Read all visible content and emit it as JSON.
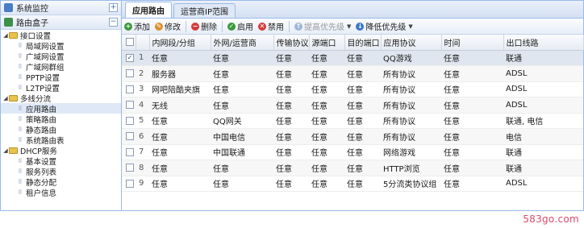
{
  "accordion": [
    {
      "label": "系统监控",
      "toggle": "+",
      "icon_color": "#4a7cc7"
    },
    {
      "label": "路由盒子",
      "toggle": "−",
      "icon_color": "#3d8f4a"
    }
  ],
  "tree": [
    {
      "label": "接口设置",
      "type": "folder",
      "level": 0,
      "arrow": "◢"
    },
    {
      "label": "局域网设置",
      "type": "leaf",
      "level": 1
    },
    {
      "label": "广域网设置",
      "type": "leaf",
      "level": 1
    },
    {
      "label": "广域网群组",
      "type": "leaf",
      "level": 1
    },
    {
      "label": "PPTP设置",
      "type": "leaf",
      "level": 1
    },
    {
      "label": "L2TP设置",
      "type": "leaf",
      "level": 1
    },
    {
      "label": "多线分流",
      "type": "folder",
      "level": 0,
      "arrow": "◢"
    },
    {
      "label": "应用路由",
      "type": "leaf",
      "level": 1,
      "selected": true
    },
    {
      "label": "策略路由",
      "type": "leaf",
      "level": 1
    },
    {
      "label": "静态路由",
      "type": "leaf",
      "level": 1
    },
    {
      "label": "系统路由表",
      "type": "leaf",
      "level": 1
    },
    {
      "label": "DHCP服务",
      "type": "folder",
      "level": 0,
      "arrow": "◢"
    },
    {
      "label": "基本设置",
      "type": "leaf",
      "level": 1
    },
    {
      "label": "服务列表",
      "type": "leaf",
      "level": 1
    },
    {
      "label": "静态分配",
      "type": "leaf",
      "level": 1
    },
    {
      "label": "租户信息",
      "type": "leaf",
      "level": 1
    }
  ],
  "tabs": [
    {
      "label": "应用路由",
      "active": true
    },
    {
      "label": "运营商IP范围",
      "active": false
    }
  ],
  "toolbar": [
    {
      "label": "添加",
      "icon": "add-icon",
      "color": "#3a9a3a",
      "glyph": "+",
      "disabled": false
    },
    {
      "label": "修改",
      "icon": "edit-icon",
      "color": "#d9902a",
      "glyph": "✎",
      "disabled": false
    },
    {
      "label": "删除",
      "icon": "delete-icon",
      "color": "#d33b3b",
      "glyph": "−",
      "disabled": false,
      "sep_before": true
    },
    {
      "label": "启用",
      "icon": "enable-icon",
      "color": "#3a9a3a",
      "glyph": "✓",
      "disabled": false,
      "sep_before": true
    },
    {
      "label": "禁用",
      "icon": "disable-icon",
      "color": "#d33b3b",
      "glyph": "✕",
      "disabled": false
    },
    {
      "label": "提高优先级",
      "icon": "priority-up-icon",
      "color": "#9fb6d8",
      "glyph": "↑",
      "disabled": true,
      "caret": true,
      "sep_before": true
    },
    {
      "label": "降低优先级",
      "icon": "priority-down-icon",
      "color": "#3b78c4",
      "glyph": "↓",
      "disabled": false,
      "caret": true
    }
  ],
  "columns": [
    "",
    "",
    "内网段/分组",
    "外网/运营商",
    "传输协议",
    "源端口",
    "目的端口",
    "应用协议",
    "时间",
    "出口线路"
  ],
  "rows": [
    {
      "num": "1",
      "lan": "任意",
      "wan": "任意",
      "proto": "任意",
      "src": "任意",
      "dst": "任意",
      "app": "QQ游戏",
      "time": "任意",
      "line": "联通",
      "checked": true
    },
    {
      "num": "2",
      "lan": "服务器",
      "wan": "任意",
      "proto": "任意",
      "src": "任意",
      "dst": "任意",
      "app": "所有协议",
      "time": "任意",
      "line": "ADSL",
      "checked": false
    },
    {
      "num": "3",
      "lan": "网吧陪酷夹旗",
      "wan": "任意",
      "proto": "任意",
      "src": "任意",
      "dst": "任意",
      "app": "所有协议",
      "time": "任意",
      "line": "ADSL",
      "checked": false
    },
    {
      "num": "4",
      "lan": "无线",
      "wan": "任意",
      "proto": "任意",
      "src": "任意",
      "dst": "任意",
      "app": "所有协议",
      "time": "任意",
      "line": "ADSL",
      "checked": false
    },
    {
      "num": "5",
      "lan": "任意",
      "wan": "QQ网关",
      "proto": "任意",
      "src": "任意",
      "dst": "任意",
      "app": "所有协议",
      "time": "任意",
      "line": "联通, 电信",
      "checked": false
    },
    {
      "num": "6",
      "lan": "任意",
      "wan": "中国电信",
      "proto": "任意",
      "src": "任意",
      "dst": "任意",
      "app": "所有协议",
      "time": "任意",
      "line": "电信",
      "checked": false
    },
    {
      "num": "7",
      "lan": "任意",
      "wan": "中国联通",
      "proto": "任意",
      "src": "任意",
      "dst": "任意",
      "app": "网络游戏",
      "time": "任意",
      "line": "联通",
      "checked": false
    },
    {
      "num": "8",
      "lan": "任意",
      "wan": "任意",
      "proto": "任意",
      "src": "任意",
      "dst": "任意",
      "app": "HTTP浏览",
      "time": "任意",
      "line": "联通",
      "checked": false
    },
    {
      "num": "9",
      "lan": "任意",
      "wan": "任意",
      "proto": "任意",
      "src": "任意",
      "dst": "任意",
      "app": "5分流类协议组",
      "time": "任意",
      "line": "ADSL",
      "checked": false
    }
  ],
  "watermark": "583go.com",
  "colors": {
    "panel_border": "#99bbe8",
    "selected_row": "#dfe6ef",
    "watermark": "#d94a6c"
  }
}
